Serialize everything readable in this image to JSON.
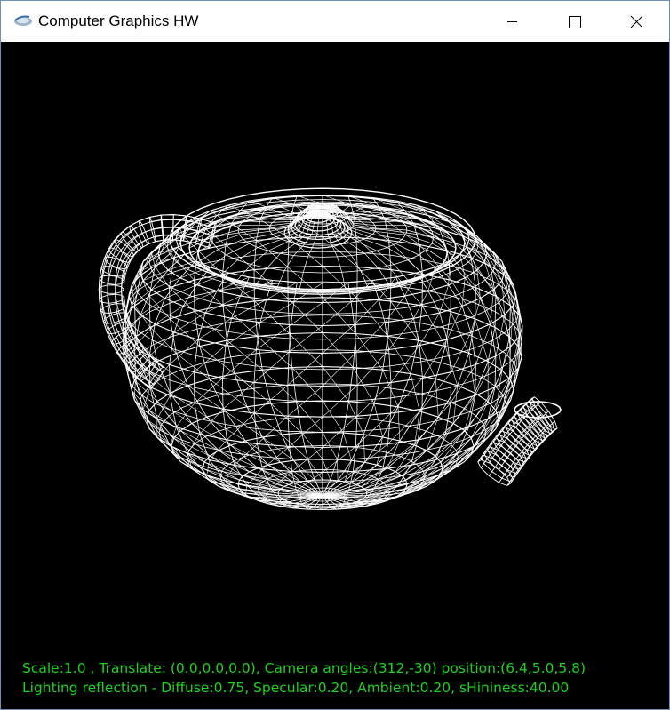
{
  "window": {
    "title": "Computer Graphics HW",
    "icon": "glut-app-icon",
    "controls": {
      "minimize": "minimize-icon",
      "maximize": "maximize-icon",
      "close": "close-icon"
    }
  },
  "viewport": {
    "background": "#000000",
    "wireframe_color": "#ffffff",
    "model": "teapot-wireframe"
  },
  "status": {
    "color": "#1fd11f",
    "line1": "Scale:1.0 , Translate: (0.0,0.0,0.0), Camera angles:(312,-30) position:(6.4,5.0,5.8)",
    "line2": "Lighting reflection - Diffuse:0.75, Specular:0.20, Ambient:0.20, sHininess:40.00"
  }
}
